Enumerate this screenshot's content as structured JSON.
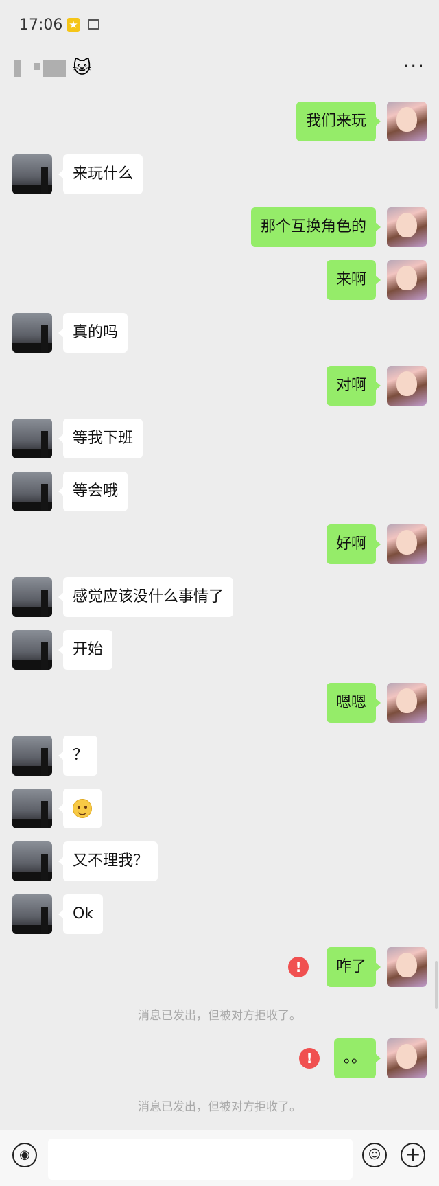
{
  "status_bar": {
    "time": "17:06"
  },
  "header": {
    "title_emoji": "🐱",
    "more": "···"
  },
  "messages": [
    {
      "side": "me",
      "text": "我们来玩"
    },
    {
      "side": "peer",
      "text": "来玩什么"
    },
    {
      "side": "me",
      "text": "那个互换角色的"
    },
    {
      "side": "me",
      "text": "来啊"
    },
    {
      "side": "peer",
      "text": "真的吗"
    },
    {
      "side": "me",
      "text": "对啊"
    },
    {
      "side": "peer",
      "text": "等我下班"
    },
    {
      "side": "peer",
      "text": "等会哦"
    },
    {
      "side": "me",
      "text": "好啊"
    },
    {
      "side": "peer",
      "text": "感觉应该没什么事情了"
    },
    {
      "side": "peer",
      "text": "开始"
    },
    {
      "side": "me",
      "text": "嗯嗯"
    },
    {
      "side": "peer",
      "text": "？"
    },
    {
      "side": "peer",
      "text": "",
      "emoji": "smiling-face"
    },
    {
      "side": "peer",
      "text": "又不理我？"
    },
    {
      "side": "peer",
      "text": "Ok"
    },
    {
      "side": "me",
      "text": "咋了",
      "failed": true
    },
    {
      "side": "me",
      "text": "。。",
      "failed": true
    }
  ],
  "rejection_notice": "消息已发出，但被对方拒收了。",
  "input_bar": {
    "placeholder": ""
  },
  "colors": {
    "background": "#ededed",
    "my_bubble": "#95ec69",
    "peer_bubble": "#ffffff",
    "error": "#f05050"
  }
}
